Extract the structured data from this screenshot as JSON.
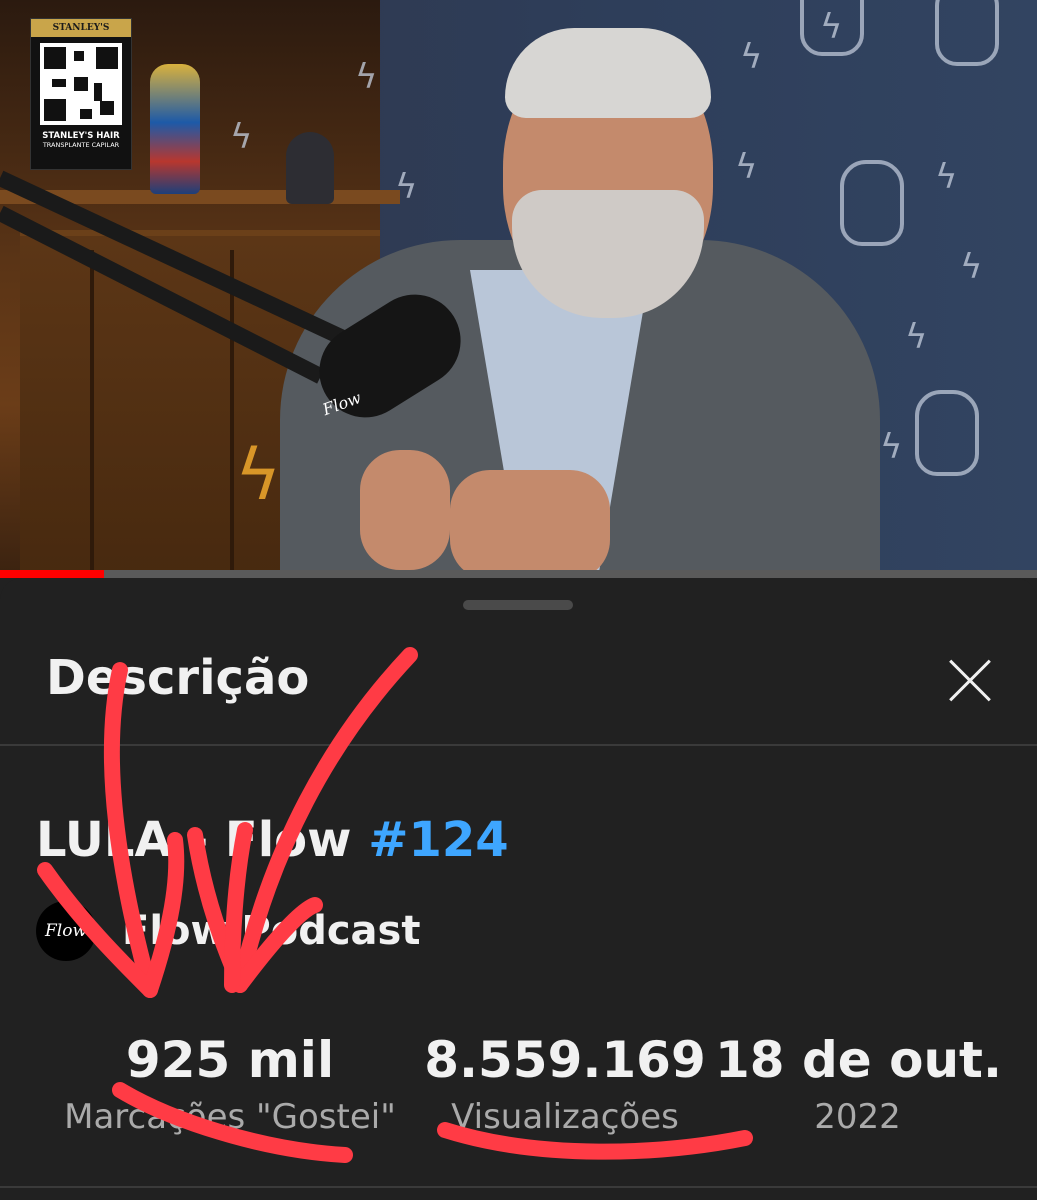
{
  "video": {
    "sponsor": {
      "brand_top": "STANLEY'S",
      "name": "STANLEY'S HAIR",
      "subtitle": "TRANSPLANTE CAPILAR"
    },
    "mic_logo": "Flow",
    "progress": 0.1
  },
  "sheet": {
    "title": "Descrição",
    "close_icon": "close-icon"
  },
  "video_info": {
    "title": "LULA - Flow",
    "hashtag": "#124",
    "channel": {
      "avatar_text": "Flow",
      "name": "Flow Podcast"
    }
  },
  "stats": [
    {
      "value": "925 mil",
      "label": "Marcações \"Gostei\""
    },
    {
      "value": "8.559.169",
      "label": "Visualizações"
    },
    {
      "value": "18 de out.",
      "label": "2022"
    }
  ],
  "colors": {
    "background": "#212121",
    "text": "#f1f1f1",
    "muted": "#aaaaaa",
    "hashtag": "#3ea6ff",
    "progress": "#ff0000",
    "annotation": "#ff3b45"
  }
}
